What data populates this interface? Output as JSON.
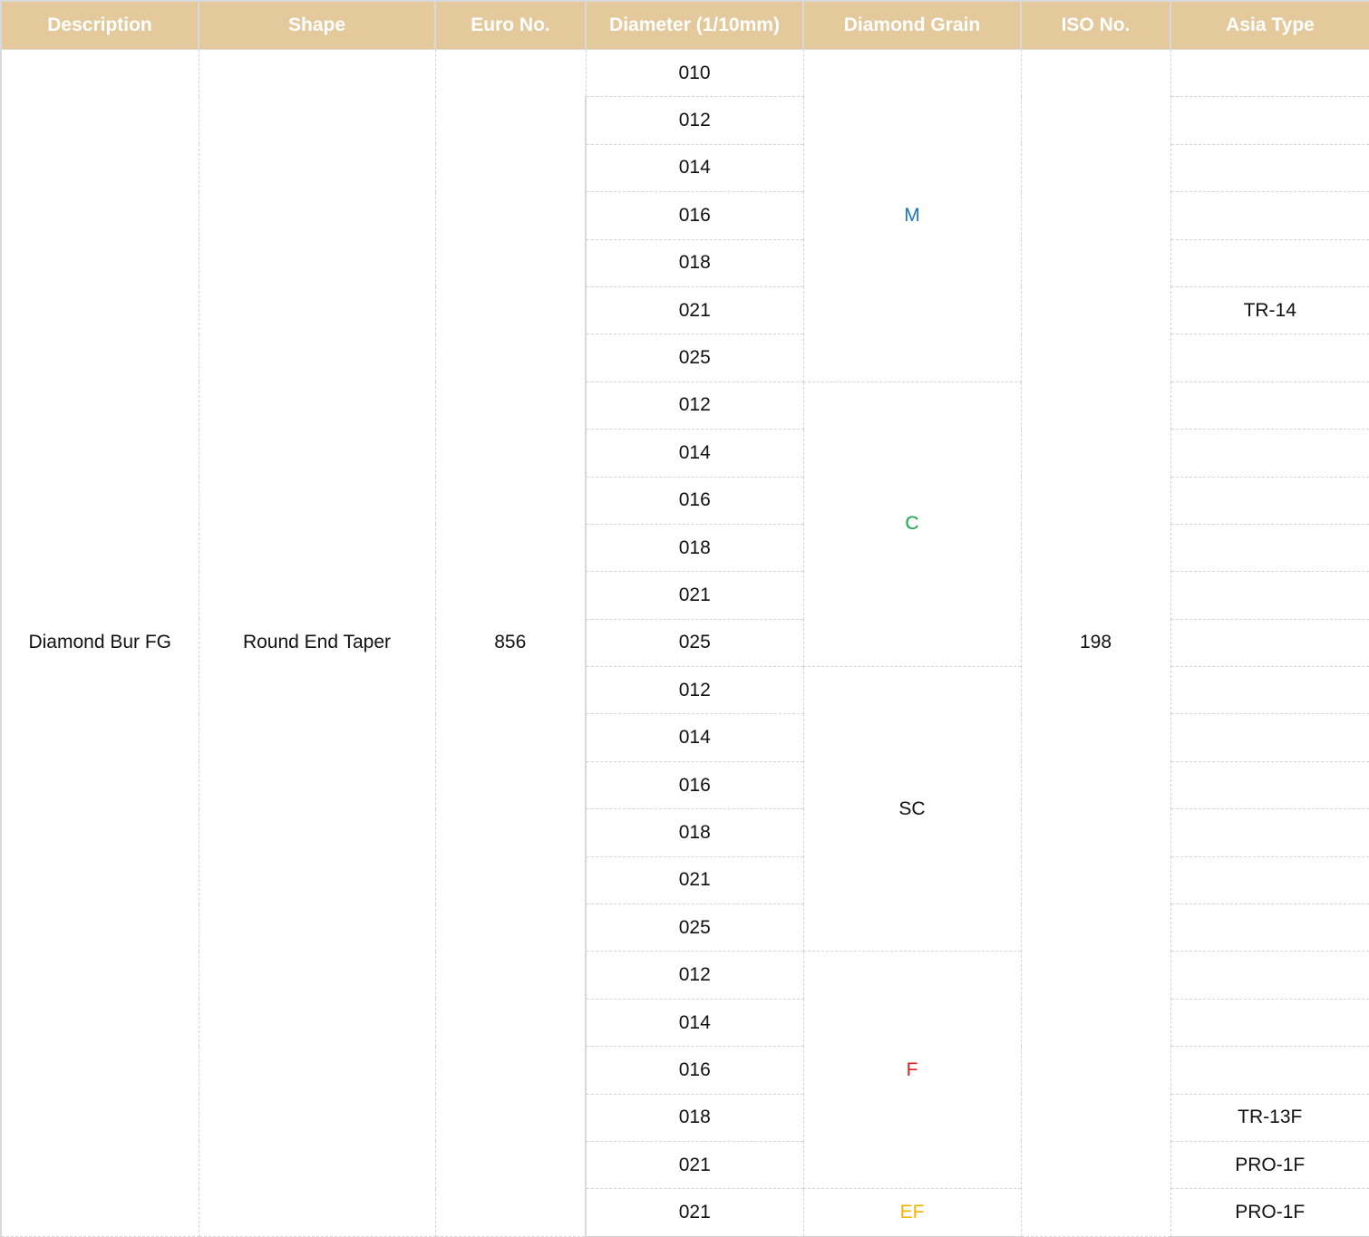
{
  "headers": [
    "Description",
    "Shape",
    "Euro No.",
    "Diameter (1/10mm)",
    "Diamond Grain",
    "ISO No.",
    "Asia Type"
  ],
  "description": "Diamond Bur FG",
  "shape": "Round End Taper",
  "euro_no": "856",
  "iso_no": "198",
  "grain_groups": [
    {
      "label": "M",
      "color": "#1f73c6",
      "rows": 7
    },
    {
      "label": "C",
      "color": "#16a34a",
      "rows": 6
    },
    {
      "label": "SC",
      "color": "#111111",
      "rows": 6
    },
    {
      "label": "F",
      "color": "#e11d1d",
      "rows": 5
    },
    {
      "label": "EF",
      "color": "#f5b400",
      "rows": 1
    }
  ],
  "diameters": [
    "010",
    "012",
    "014",
    "016",
    "018",
    "021",
    "025",
    "012",
    "014",
    "016",
    "018",
    "021",
    "025",
    "012",
    "014",
    "016",
    "018",
    "021",
    "025",
    "012",
    "014",
    "016",
    "018",
    "021",
    "021"
  ],
  "asia_types": [
    "",
    "",
    "",
    "",
    "",
    "TR-14",
    "",
    "",
    "",
    "",
    "",
    "",
    "",
    "",
    "",
    "",
    "",
    "",
    "",
    "",
    "",
    "",
    "TR-13F",
    "PRO-1F",
    "PRO-1F"
  ]
}
